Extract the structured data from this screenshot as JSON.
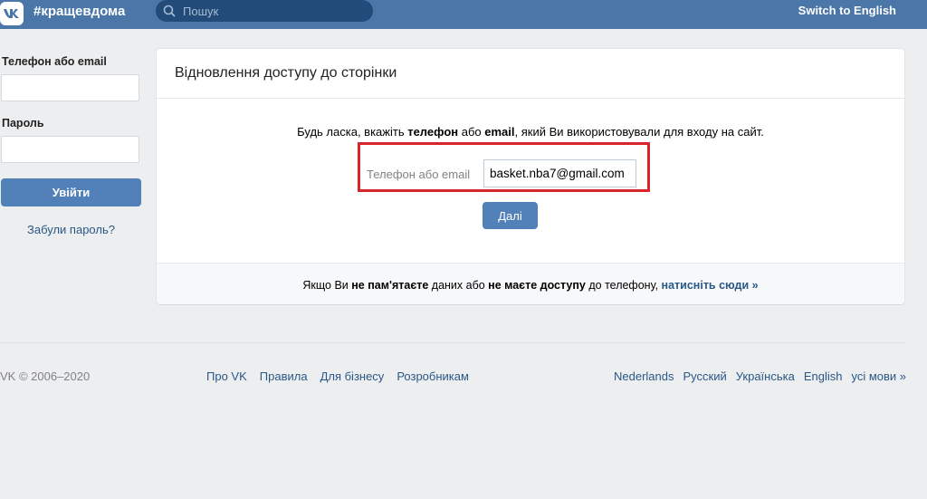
{
  "header": {
    "brand": "#кращевдома",
    "search_placeholder": "Пошук",
    "switch_lang": "Switch to English"
  },
  "login": {
    "phone_label": "Телефон або email",
    "password_label": "Пароль",
    "login_button": "Увійти",
    "forgot": "Забули пароль?"
  },
  "card": {
    "title": "Відновлення доступу до сторінки",
    "instr_prefix": "Будь ласка, вкажіть ",
    "instr_phone": "телефон",
    "instr_or": " або ",
    "instr_email": "email",
    "instr_suffix": ", який Ви використовували для входу на сайт.",
    "field_label": "Телефон або email",
    "field_value": "basket.nba7@gmail.com",
    "next_button": "Далі",
    "footer_prefix": "Якщо Ви ",
    "footer_bold1": "не пам'ятаєте",
    "footer_mid": " даних або ",
    "footer_bold2": "не маєте доступу",
    "footer_mid2": " до телефону, ",
    "footer_link": "натисніть сюди »"
  },
  "footer": {
    "copyright": "VK © 2006–2020",
    "links": [
      "Про VK",
      "Правила",
      "Для бізнесу",
      "Розробникам"
    ],
    "langs": [
      "Nederlands",
      "Русский",
      "Українська",
      "English",
      "усі мови »"
    ]
  },
  "colors": {
    "header": "#4a76a8",
    "accent": "#5181b8",
    "link": "#2a5885",
    "highlight": "#d9242a"
  }
}
